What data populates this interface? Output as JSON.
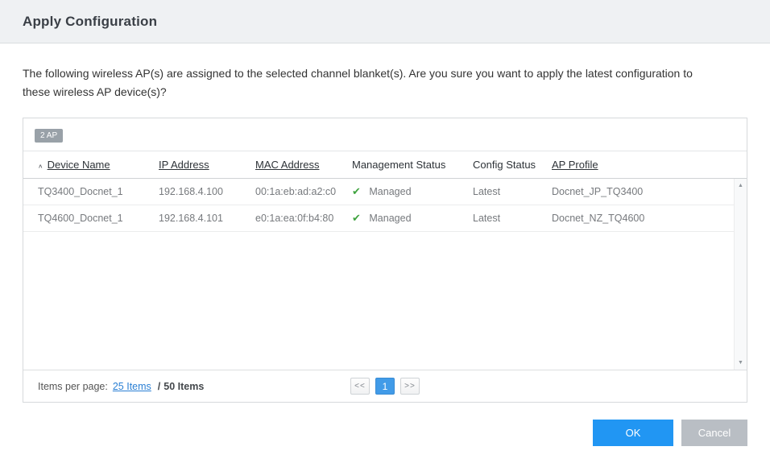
{
  "header": {
    "title": "Apply Configuration"
  },
  "message": "The following wireless AP(s) are assigned to the selected channel blanket(s). Are you sure you want to apply the latest configuration to these wireless AP device(s)?",
  "table": {
    "count_badge": "2 AP",
    "columns": [
      {
        "label": "Device Name"
      },
      {
        "label": "IP Address"
      },
      {
        "label": "MAC Address"
      },
      {
        "label": "Management Status"
      },
      {
        "label": "Config Status"
      },
      {
        "label": "AP Profile"
      }
    ],
    "rows": [
      {
        "device_name": "TQ3400_Docnet_1",
        "ip_address": "192.168.4.100",
        "mac_address": "00:1a:eb:ad:a2:c0",
        "management_status": "Managed",
        "config_status": "Latest",
        "ap_profile": "Docnet_JP_TQ3400"
      },
      {
        "device_name": "TQ4600_Docnet_1",
        "ip_address": "192.168.4.101",
        "mac_address": "e0:1a:ea:0f:b4:80",
        "management_status": "Managed",
        "config_status": "Latest",
        "ap_profile": "Docnet_NZ_TQ4600"
      }
    ],
    "footer": {
      "items_per_page_label": "Items per page:",
      "items_per_page_value": "25 Items",
      "separator": "/",
      "total_items": "50 Items"
    },
    "pagination": {
      "prev": "<<",
      "page": "1",
      "next": ">>"
    }
  },
  "icons": {
    "sort_asc": "∧",
    "check": "✔",
    "scroll_up": "▲",
    "scroll_down": "▼"
  },
  "buttons": {
    "ok": "OK",
    "cancel": "Cancel"
  },
  "colors": {
    "accent_blue": "#2196f3",
    "link_blue": "#2a7fd4",
    "success_green": "#3fa33f",
    "badge_gray": "#99a1a8",
    "cancel_gray": "#b9bec4"
  }
}
